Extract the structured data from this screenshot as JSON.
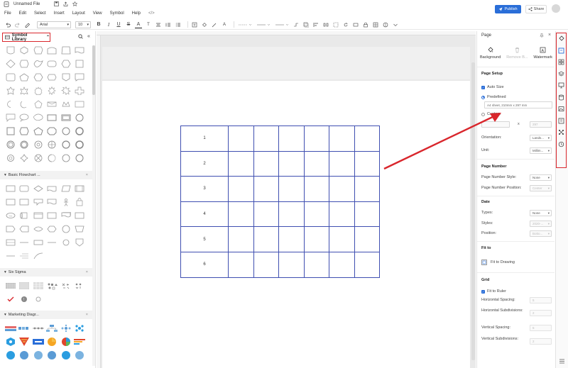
{
  "app": {
    "title": "Unnamed File"
  },
  "menu": [
    "File",
    "Edit",
    "Select",
    "Insert",
    "Layout",
    "View",
    "Symbol",
    "Help"
  ],
  "header": {
    "publish_label": "Publish",
    "share_label": "Share"
  },
  "toolbar": {
    "font": "Arial",
    "font_size": "10"
  },
  "symbol_library": {
    "title": "Symbol Library",
    "sections": [
      {
        "name": "Basic Flowchart ..."
      },
      {
        "name": "Six Sigma"
      },
      {
        "name": "Marketing Diagr..."
      }
    ]
  },
  "table": {
    "rows": [
      "1",
      "2",
      "3",
      "4",
      "5",
      "6"
    ],
    "extra_columns": 6
  },
  "page_panel": {
    "title": "Page",
    "tabs": [
      "Background",
      "Remove B...",
      "Watermark"
    ],
    "page_setup": {
      "title": "Page Setup",
      "auto_size": "Auto Size",
      "predefined": "Predefined",
      "predefined_value": "A4 sheet, 210mm x 297 mm",
      "custom": "Custom",
      "custom_x": "x",
      "custom_w": "210",
      "custom_h": "297",
      "orientation_label": "Orientation:",
      "orientation_value": "Lands...",
      "unit_label": "Unit:",
      "unit_value": "Millim..."
    },
    "page_number": {
      "title": "Page Number",
      "style_label": "Page Number Style:",
      "style_value": "None",
      "position_label": "Page Number Position:",
      "position_value": "Center"
    },
    "date": {
      "title": "Date",
      "types_label": "Types:",
      "types_value": "None",
      "styles_label": "Styles:",
      "styles_value": "2020-...",
      "position_label": "Position:",
      "position_value": "Botto..."
    },
    "fit_to": {
      "title": "Fit to",
      "fit_drawing": "Fit to Drawing"
    },
    "grid": {
      "title": "Grid",
      "fit_ruler": "Fit to Ruler",
      "h_spacing_label": "Horizontal Spacing:",
      "h_spacing_value": "5",
      "h_subdiv_label": "Horizontal Subdivisions:",
      "h_subdiv_value": "2",
      "v_spacing_label": "Vertical Spacing:",
      "v_spacing_value": "5",
      "v_subdiv_label": "Vertical Subdivisions:",
      "v_subdiv_value": "2"
    }
  },
  "colors": {
    "accent": "#2a6ed8",
    "highlight": "#d9262c",
    "table_border": "#3f4fb1"
  }
}
